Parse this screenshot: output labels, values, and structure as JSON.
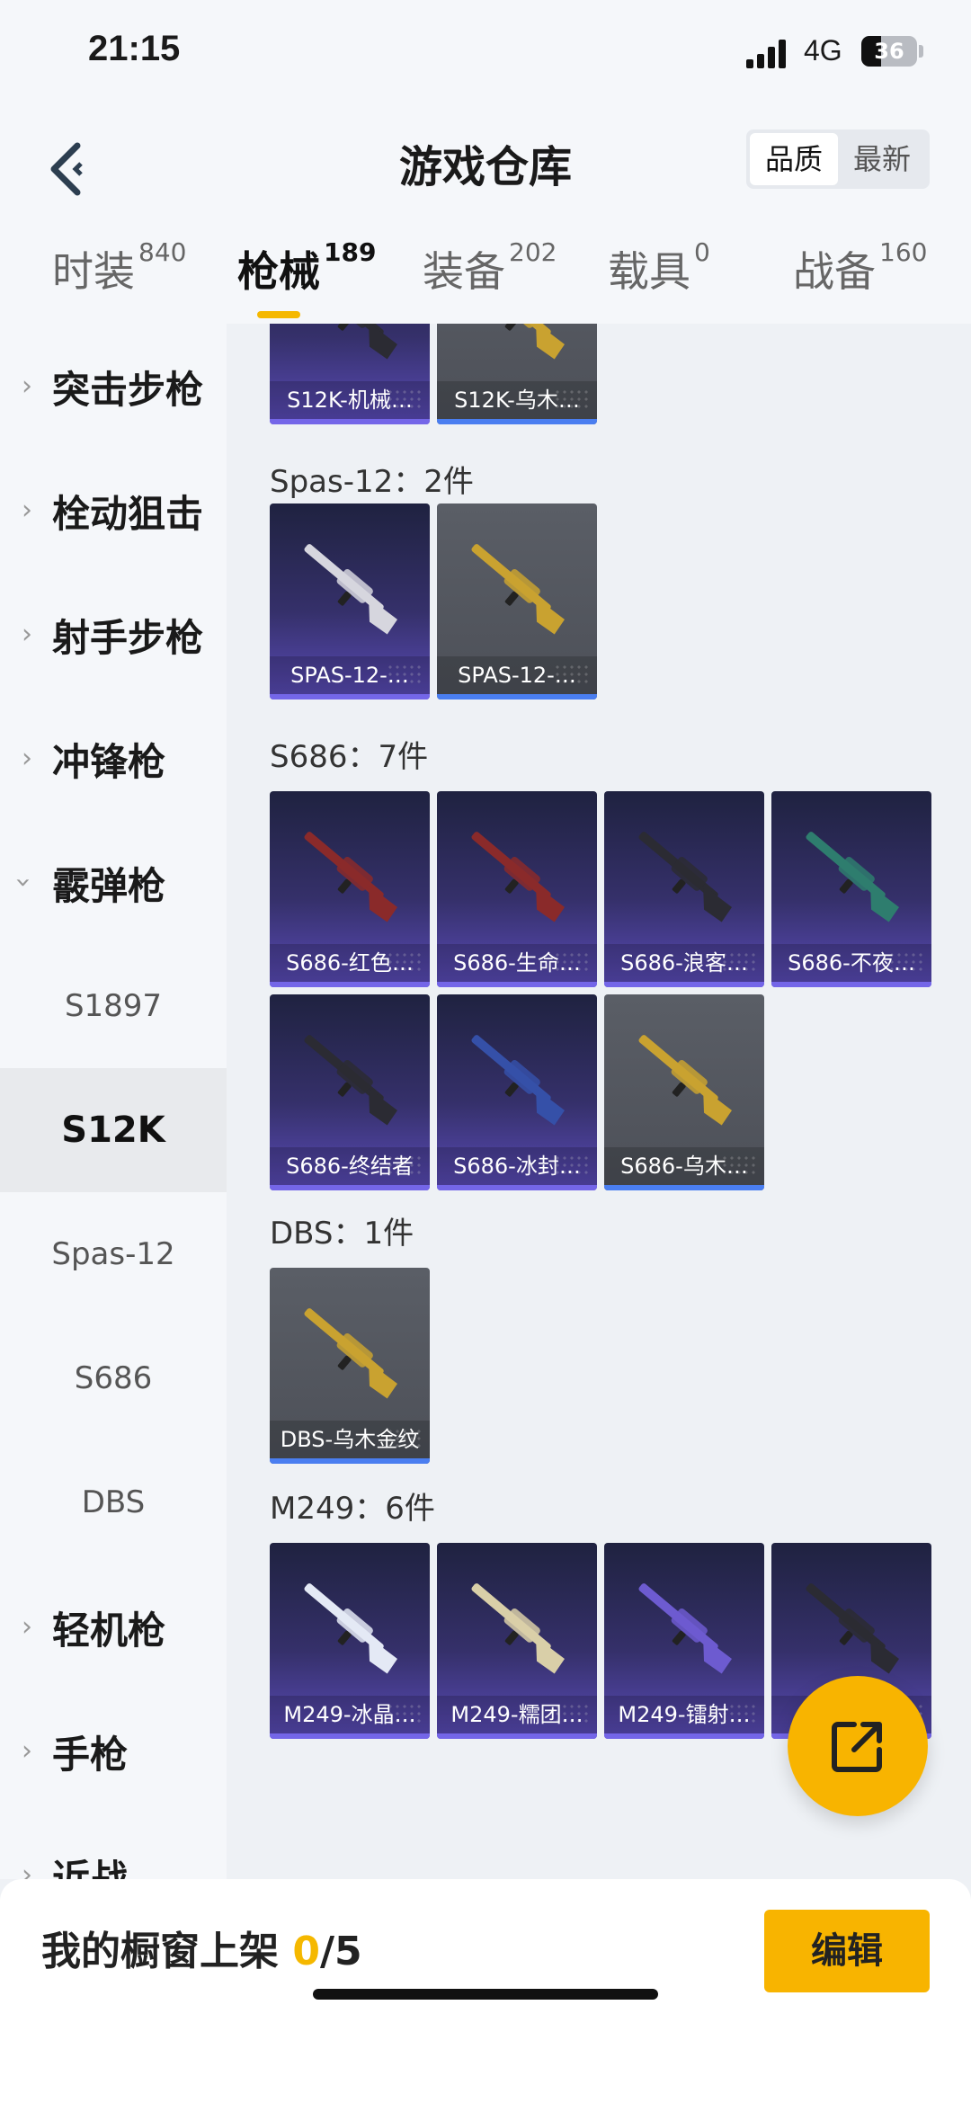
{
  "status": {
    "time": "21:15",
    "network": "4G",
    "battery": "36",
    "battery_level": 0.36
  },
  "header": {
    "title": "游戏仓库",
    "sort": [
      "品质",
      "最新"
    ]
  },
  "tabs": [
    {
      "label": "时装",
      "count": "840"
    },
    {
      "label": "枪械",
      "count": "189"
    },
    {
      "label": "装备",
      "count": "202"
    },
    {
      "label": "载具",
      "count": "0"
    },
    {
      "label": "战备",
      "count": "160"
    }
  ],
  "sidebar": {
    "categories": [
      "突击步枪",
      "栓动狙击",
      "射手步枪",
      "冲锋枪",
      "霰弹枪",
      "轻机枪",
      "手枪",
      "近战"
    ],
    "shotgun_subs": [
      "S1897",
      "S12K",
      "Spas-12",
      "S686",
      "DBS"
    ]
  },
  "groups": {
    "s12k": {
      "items": [
        "S12K-机械…",
        "S12K-乌木…"
      ]
    },
    "spas": {
      "title": "Spas-12：2件",
      "items": [
        "SPAS-12-…",
        "SPAS-12-…"
      ]
    },
    "s686": {
      "title": "S686：7件",
      "items": [
        "S686-红色…",
        "S686-生命…",
        "S686-浪客…",
        "S686-不夜…",
        "S686-终结者",
        "S686-冰封…",
        "S686-乌木…"
      ]
    },
    "dbs": {
      "title": "DBS：1件",
      "items": [
        "DBS-乌木金纹"
      ]
    },
    "m249": {
      "title": "M249：6件",
      "items": [
        "M249-冰晶…",
        "M249-糯团…",
        "M249-镭射…",
        "M…"
      ]
    }
  },
  "footer": {
    "showcase_label": "我的橱窗上架",
    "showcase_count": "0",
    "showcase_total": "/5",
    "edit_label": "编辑"
  }
}
